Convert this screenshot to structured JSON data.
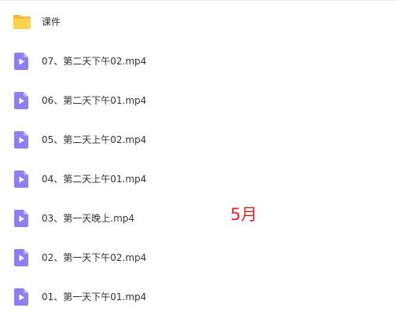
{
  "colors": {
    "folder": "#f9c53c",
    "video": "#8a7cf0",
    "annotation": "#e32222"
  },
  "items": [
    {
      "name": "课件",
      "icon": "folder-icon"
    },
    {
      "name": "07、第二天下午02.mp4",
      "icon": "video-file-icon"
    },
    {
      "name": "06、第二天下午01.mp4",
      "icon": "video-file-icon"
    },
    {
      "name": "05、第二天上午02.mp4",
      "icon": "video-file-icon"
    },
    {
      "name": "04、第二天上午01.mp4",
      "icon": "video-file-icon"
    },
    {
      "name": "03、第一天晚上.mp4",
      "icon": "video-file-icon"
    },
    {
      "name": "02、第一天下午02.mp4",
      "icon": "video-file-icon"
    },
    {
      "name": "01、第一天下午01.mp4",
      "icon": "video-file-icon"
    }
  ],
  "annotation": "5月"
}
